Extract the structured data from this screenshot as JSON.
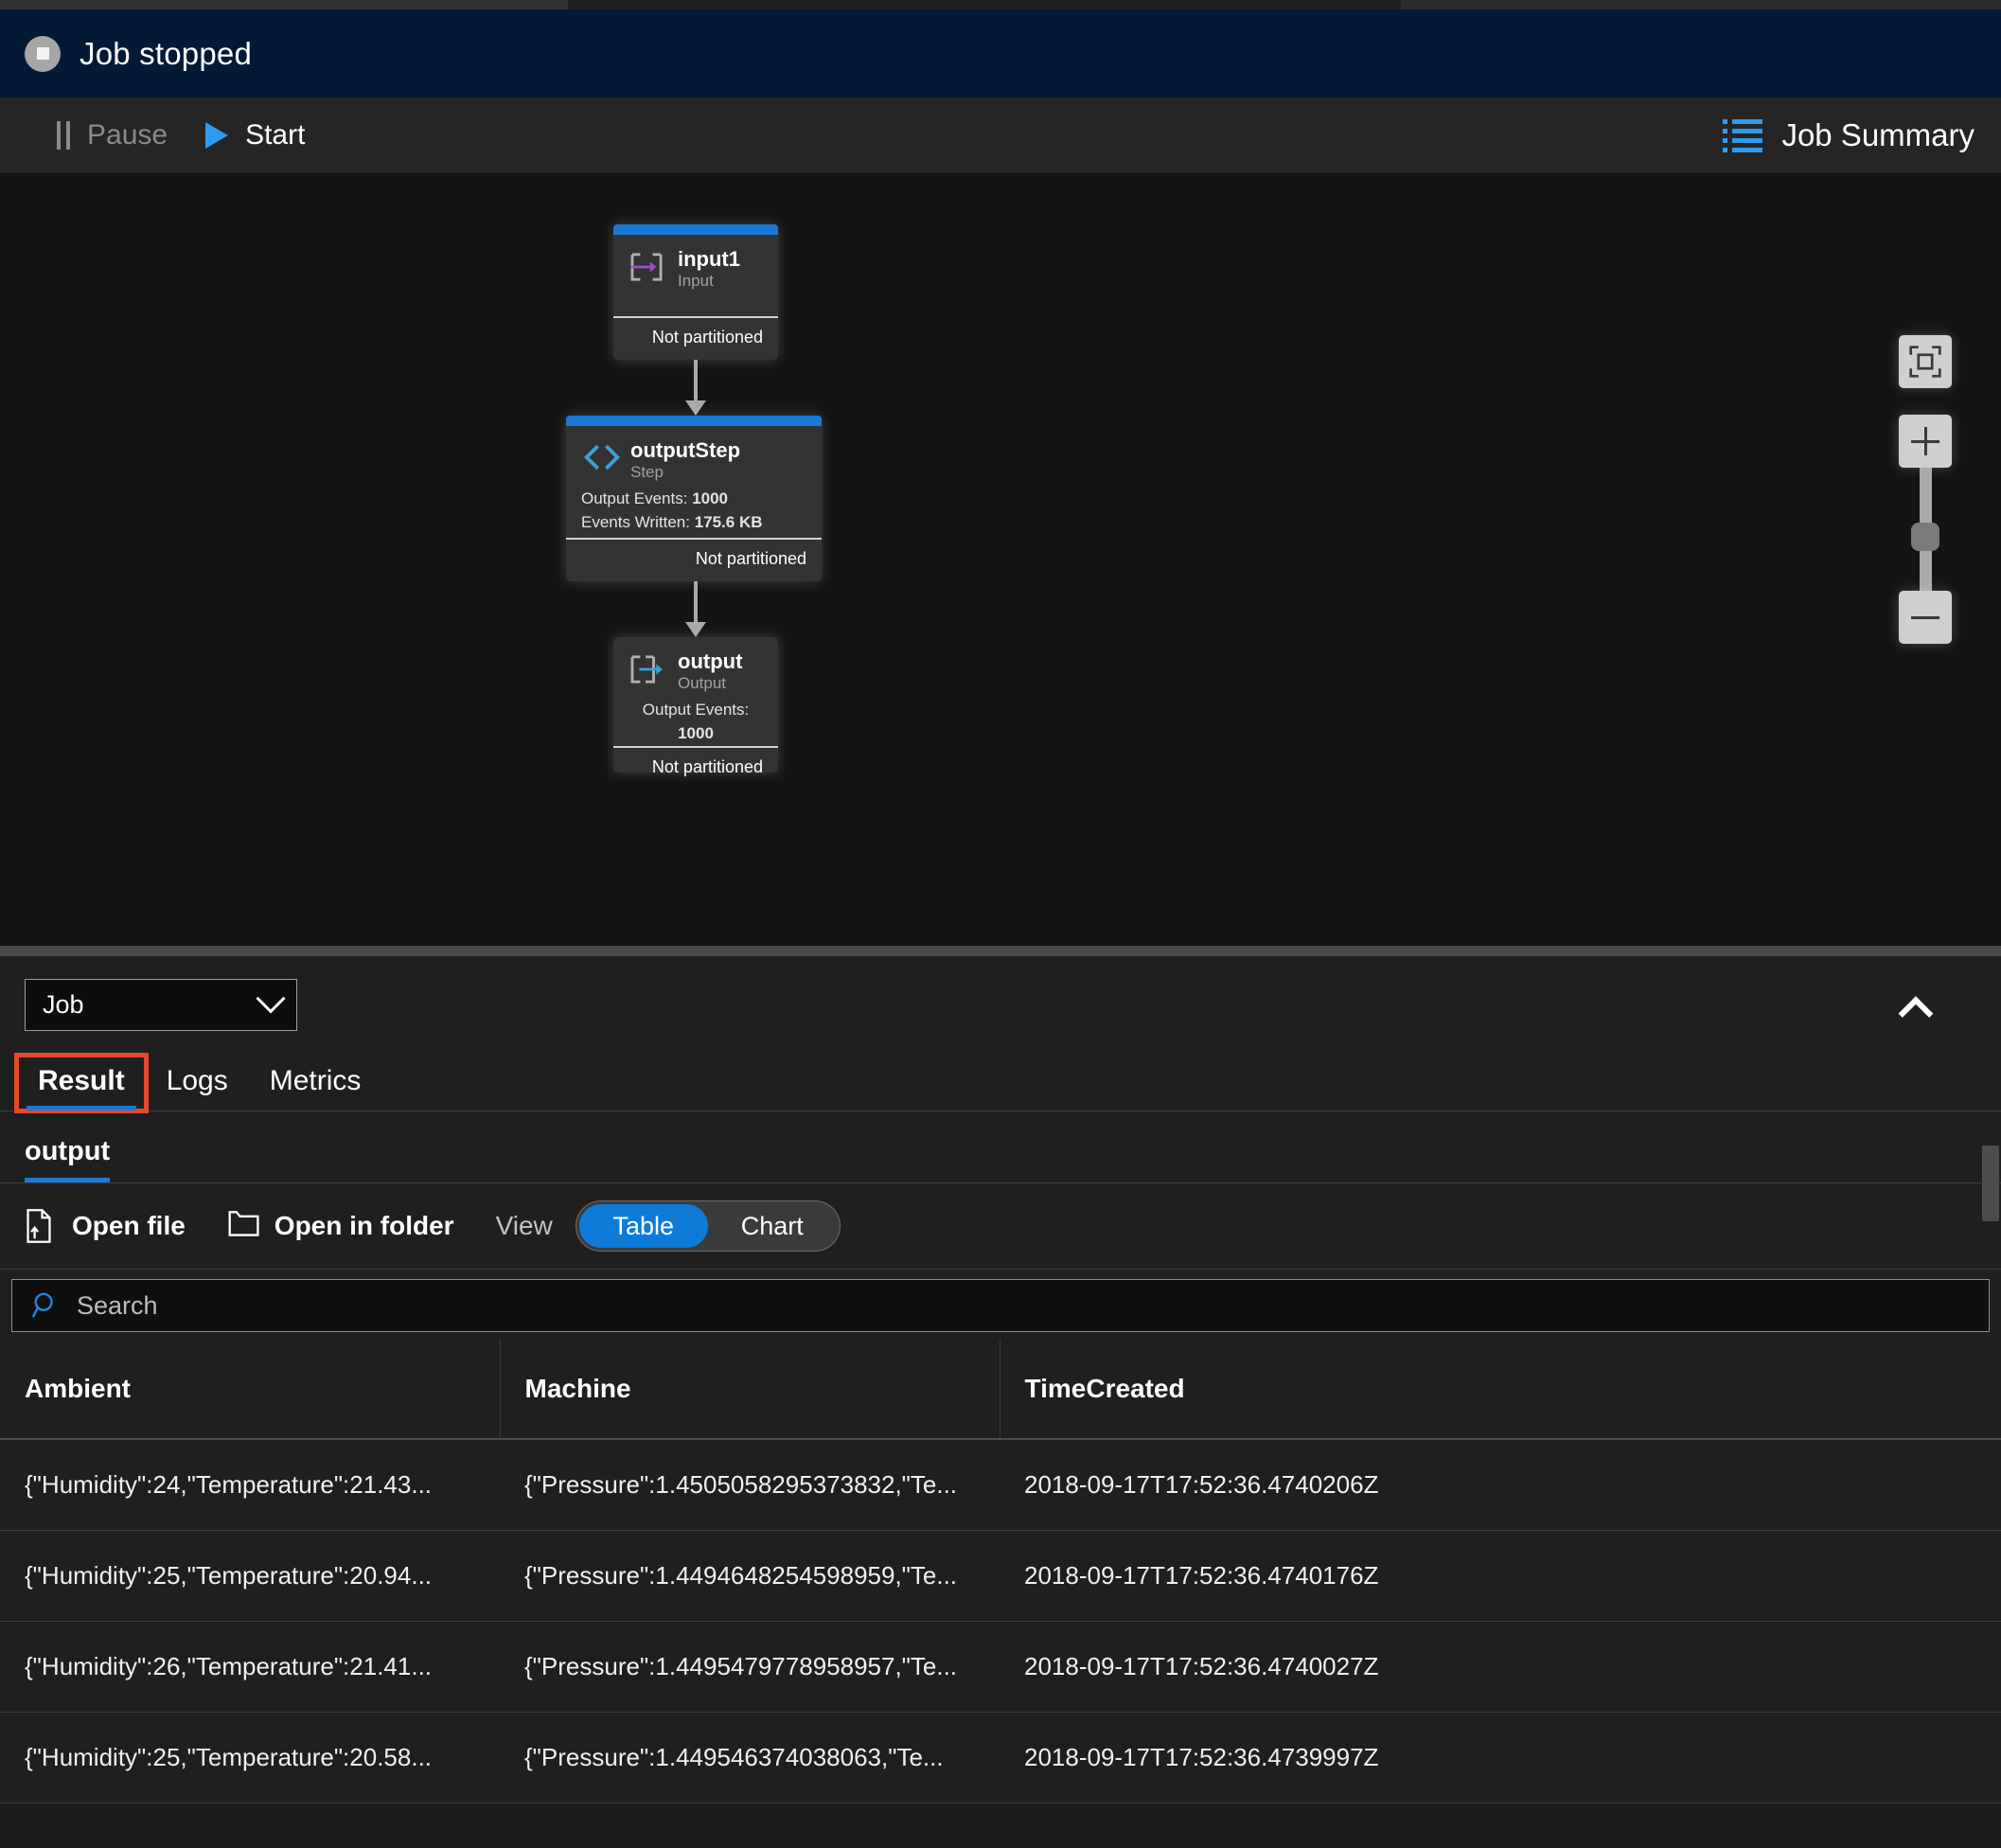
{
  "status_banner": {
    "icon": "stop-icon",
    "text": "Job stopped"
  },
  "command_bar": {
    "pause_label": "Pause",
    "start_label": "Start",
    "job_summary_label": "Job Summary"
  },
  "diagram": {
    "nodes": [
      {
        "name": "input1",
        "type": "Input",
        "icon": "input-arrow-icon",
        "metrics": [],
        "partition": "Not partitioned"
      },
      {
        "name": "outputStep",
        "type": "Step",
        "icon": "code-brackets-icon",
        "metrics": [
          {
            "label": "Output Events:",
            "value": "1000"
          },
          {
            "label": "Events Written:",
            "value": "175.6 KB"
          }
        ],
        "partition": "Not partitioned"
      },
      {
        "name": "output",
        "type": "Output",
        "icon": "output-arrow-icon",
        "metrics": [
          {
            "label": "Output Events:",
            "value": "1000"
          }
        ],
        "partition": "Not partitioned"
      }
    ],
    "zoom_controls": {
      "fit_label": "fit-to-screen-icon",
      "zoom_in_label": "plus-icon",
      "zoom_out_label": "minus-icon"
    }
  },
  "panel": {
    "scope_select": {
      "value": "Job"
    },
    "collapse_icon": "chevron-up-icon",
    "tabs": [
      {
        "label": "Result",
        "active": true,
        "highlighted": true
      },
      {
        "label": "Logs",
        "active": false,
        "highlighted": false
      },
      {
        "label": "Metrics",
        "active": false,
        "highlighted": false
      }
    ],
    "sub_tab": {
      "label": "output",
      "active": true
    },
    "toolbar": {
      "open_file_label": "Open file",
      "open_folder_label": "Open in folder",
      "view_label": "View",
      "view_options": [
        {
          "label": "Table",
          "selected": true
        },
        {
          "label": "Chart",
          "selected": false
        }
      ]
    },
    "search": {
      "placeholder": "Search",
      "value": ""
    },
    "table": {
      "columns": [
        "Ambient",
        "Machine",
        "TimeCreated"
      ],
      "rows": [
        [
          "{\"Humidity\":24,\"Temperature\":21.43...",
          "{\"Pressure\":1.4505058295373832,\"Te...",
          "2018-09-17T17:52:36.4740206Z"
        ],
        [
          "{\"Humidity\":25,\"Temperature\":20.94...",
          "{\"Pressure\":1.4494648254598959,\"Te...",
          "2018-09-17T17:52:36.4740176Z"
        ],
        [
          "{\"Humidity\":26,\"Temperature\":21.41...",
          "{\"Pressure\":1.4495479778958957,\"Te...",
          "2018-09-17T17:52:36.4740027Z"
        ],
        [
          "{\"Humidity\":25,\"Temperature\":20.58...",
          "{\"Pressure\":1.449546374038063,\"Te...",
          "2018-09-17T17:52:36.4739997Z"
        ]
      ]
    }
  },
  "colors": {
    "accent_blue": "#1a79d6",
    "banner_navy": "#041935",
    "highlight_red": "#e8472c",
    "toggle_blue": "#0f7bd8"
  }
}
